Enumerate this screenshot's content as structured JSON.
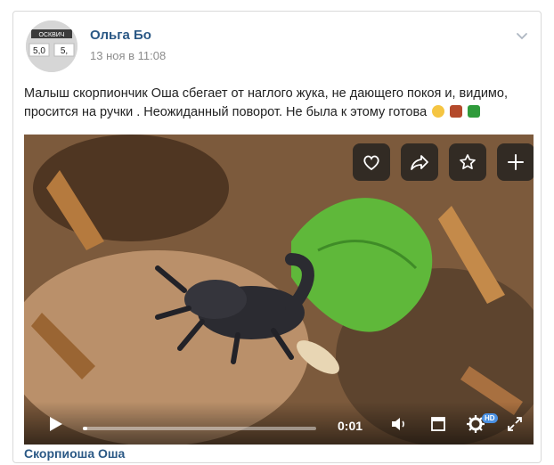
{
  "post": {
    "author": "Ольга Бо",
    "date": "13 ноя в 11:08",
    "avatar_text_top": "ОСКВИЧ",
    "avatar_text_left": "5,0",
    "avatar_text_right": "5,",
    "text": "Малыш скорпиончик Оша сбегает от наглого жука, не дающего покоя и, видимо, просится на ручки . Неожиданный поворот. Не была к этому готова"
  },
  "video": {
    "actions": [
      "heart-icon",
      "share-icon",
      "star-icon",
      "plus-icon"
    ],
    "time": "0:01",
    "progress": 0.02,
    "title": "Скорпиоша Оша",
    "hd_label": "HD"
  },
  "colors": {
    "link": "#2a5885",
    "muted": "#8c8c8c",
    "overlay": "#1e1e1e",
    "accent": "#4a90e2"
  }
}
